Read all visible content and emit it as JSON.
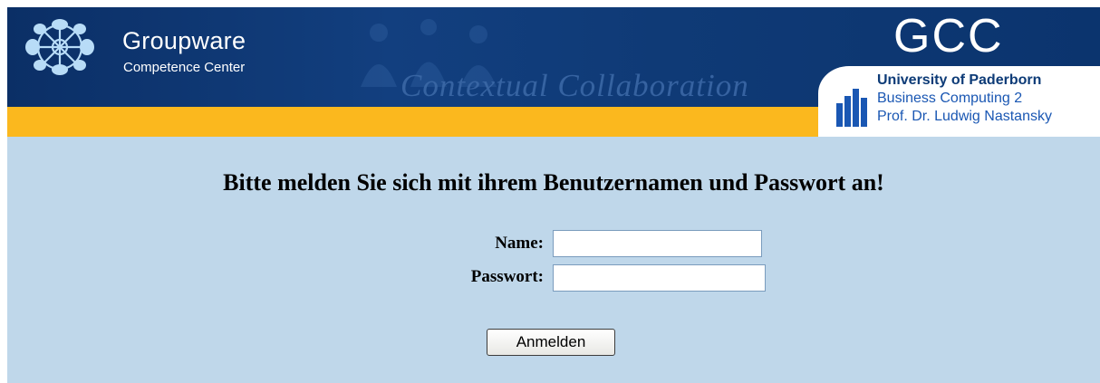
{
  "header": {
    "brand_title": "Groupware",
    "brand_subtitle": "Competence Center",
    "tagline": "Contextual Collaboration",
    "acronym": "GCC",
    "university": "University of Paderborn",
    "department": "Business Computing 2",
    "professor": "Prof. Dr. Ludwig Nastansky",
    "colors": {
      "blue": "#0e3a78",
      "yellow": "#fbb81e",
      "content_bg": "#bfd7ea"
    },
    "icons": [
      "groupware-logo-icon",
      "university-logo-icon"
    ]
  },
  "login": {
    "heading": "Bitte melden Sie sich mit ihrem Benutzernamen und Passwort an!",
    "name_label": "Name:",
    "name_value": "",
    "password_label": "Passwort:",
    "password_value": "",
    "submit_label": "Anmelden"
  }
}
